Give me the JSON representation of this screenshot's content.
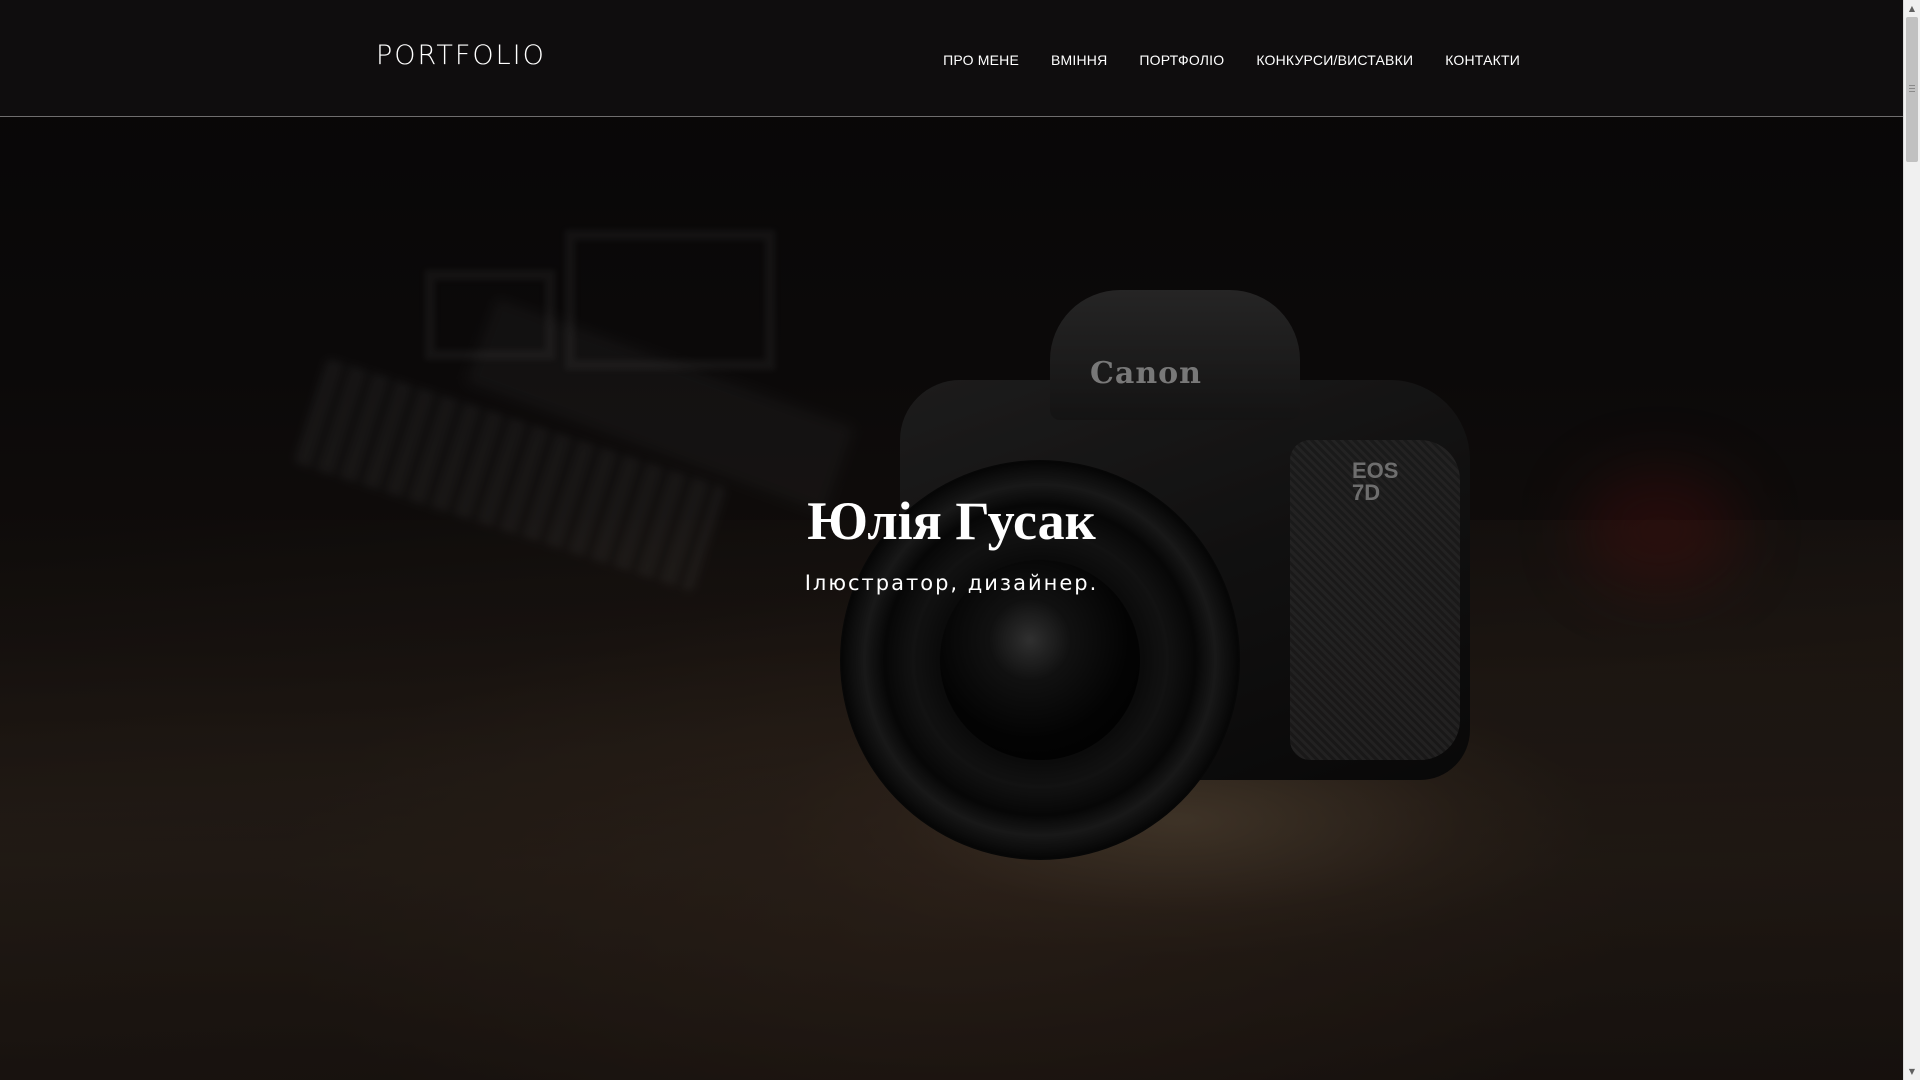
{
  "header": {
    "logo": "PORTFOLIO",
    "nav": [
      {
        "label": "ПРО МЕНЕ"
      },
      {
        "label": "ВМІННЯ"
      },
      {
        "label": "ПОРТФОЛІО"
      },
      {
        "label": "КОНКУРСИ/ВИСТАВКИ"
      },
      {
        "label": "КОНТАКТИ"
      }
    ]
  },
  "hero": {
    "name": "Юлія Гусак",
    "subtitle": "Ілюстратор, дизайнер.",
    "photo": {
      "brand_text": "Canon",
      "model_text": "EOS 7D"
    }
  },
  "scrollbar": {
    "up_icon": "triangle-up-icon",
    "down_icon": "triangle-down-icon"
  },
  "colors": {
    "header_bg": "#0f0d0e",
    "header_border": "#6f6d6e",
    "text": "#ffffff"
  }
}
